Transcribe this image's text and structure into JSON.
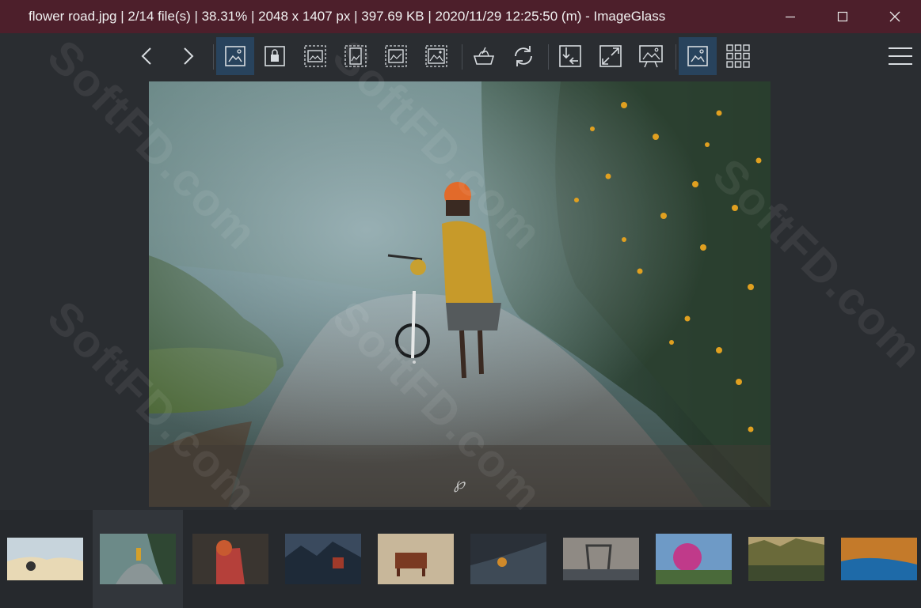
{
  "window": {
    "title": "flower road.jpg  |  2/14 file(s)  |  38.31%  |  2048 x 1407 px  |  397.69 KB  |  2020/11/29 12:25:50 (m)  - ImageGlass",
    "minimize_icon": "minimize-icon",
    "maximize_icon": "maximize-icon",
    "close_icon": "close-icon"
  },
  "toolbar": {
    "items": [
      {
        "name": "previous-image",
        "icon": "chevron-left-icon"
      },
      {
        "name": "next-image",
        "icon": "chevron-right-icon"
      },
      {
        "name": "auto-zoom",
        "icon": "image-fit-icon",
        "active": true
      },
      {
        "name": "lock-zoom",
        "icon": "lock-icon"
      },
      {
        "name": "scale-to-width",
        "icon": "scale-width-icon"
      },
      {
        "name": "scale-to-height",
        "icon": "scale-height-icon"
      },
      {
        "name": "scale-to-fit",
        "icon": "scale-fit-icon"
      },
      {
        "name": "scale-to-fill",
        "icon": "scale-fill-icon"
      },
      {
        "name": "color-picker",
        "icon": "tray-icon"
      },
      {
        "name": "rotate",
        "icon": "rotate-icon"
      },
      {
        "name": "open-file",
        "icon": "import-icon"
      },
      {
        "name": "full-screen",
        "icon": "expand-icon"
      },
      {
        "name": "slideshow",
        "icon": "slideshow-icon"
      },
      {
        "name": "thumbnail-bar",
        "icon": "image-icon",
        "active": true
      },
      {
        "name": "gallery",
        "icon": "grid-icon"
      }
    ],
    "menu_icon": "hamburger-menu-icon"
  },
  "watermark": "SoftFD.com",
  "thumbnails": [
    {
      "name": "thumb-foggy-hills"
    },
    {
      "name": "thumb-flower-road",
      "selected": true
    },
    {
      "name": "thumb-red-umbrella"
    },
    {
      "name": "thumb-mountain-range"
    },
    {
      "name": "thumb-brown-cow"
    },
    {
      "name": "thumb-dark-autumn"
    },
    {
      "name": "thumb-old-bridge"
    },
    {
      "name": "thumb-pink-tree"
    },
    {
      "name": "thumb-misty-forest"
    },
    {
      "name": "thumb-blue-lake"
    }
  ],
  "colors": {
    "titlebar": "#4d1f2b",
    "background": "#2a2d31",
    "active_button": "#28435d",
    "icon": "#d8dce0"
  }
}
